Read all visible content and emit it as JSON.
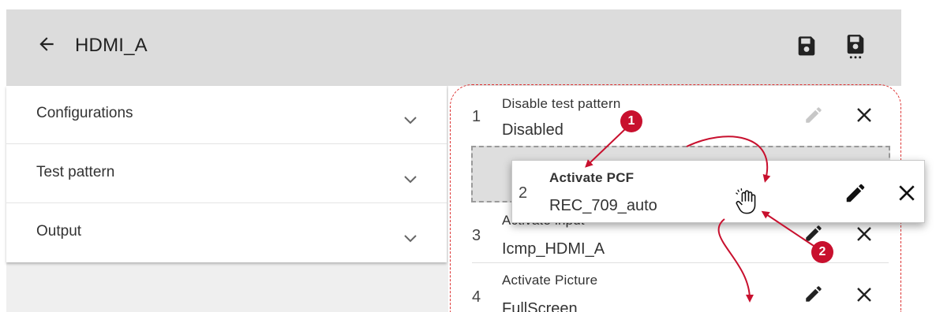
{
  "header": {
    "title": "HDMI_A",
    "back_icon": "arrow-left-icon",
    "save_icon": "save-icon",
    "save_as_icon": "save-as-icon"
  },
  "accordion": [
    {
      "label": "Configurations"
    },
    {
      "label": "Test pattern"
    },
    {
      "label": "Output"
    }
  ],
  "steps": [
    {
      "num": "1",
      "title": "Disable test pattern",
      "value": "Disabled"
    },
    {
      "num": "2",
      "title": "Activate PCF",
      "value": "REC_709_auto"
    },
    {
      "num": "3",
      "title": "Activate input",
      "value": "Icmp_HDMI_A"
    },
    {
      "num": "4",
      "title": "Activate Picture",
      "value": "FullScreen"
    }
  ],
  "callouts": {
    "one": "1",
    "two": "2"
  },
  "colors": {
    "toolbar": "#dcdcdc",
    "annotation_red": "#c8102e",
    "icon_dark": "#222222",
    "icon_disabled": "#c7c7c7"
  }
}
